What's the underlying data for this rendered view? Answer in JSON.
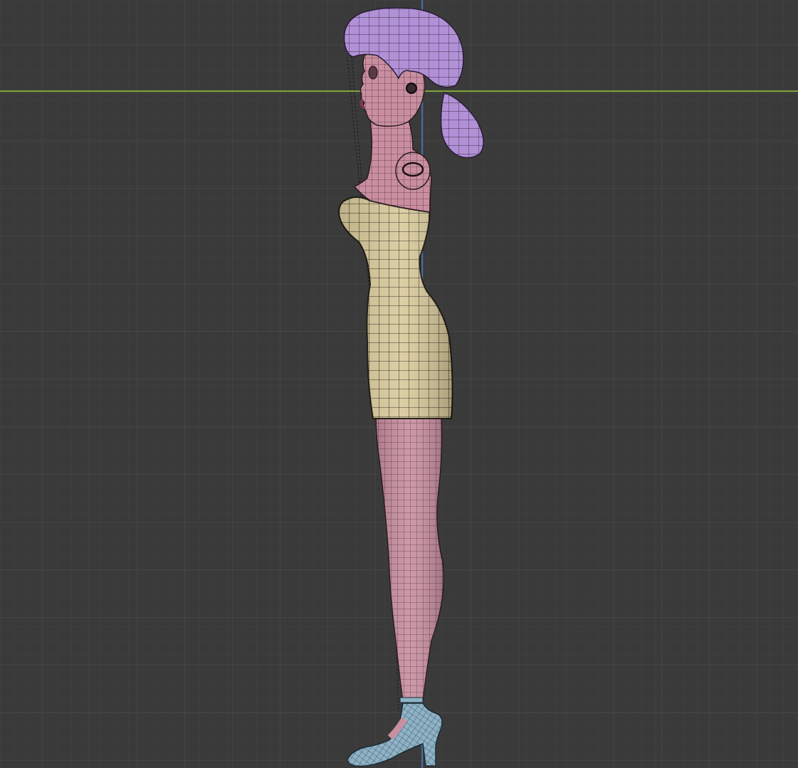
{
  "viewport": {
    "view": "side-orthographic",
    "grid": true,
    "colors": {
      "background": "#3a3a3a",
      "grid_minor": "#414141",
      "grid_major": "#4a4a4a",
      "axis_y": "#7fa535",
      "axis_z": "#4a7bc9",
      "skin": "#c98fa0",
      "skin_dark": "#a36b7c",
      "dress": "#d8c99a",
      "dress_dark": "#b8a574",
      "hair": "#b191d6",
      "hair_dark": "#8a6bb0",
      "shoe": "#8fb2c6",
      "wire": "#1a1a1a"
    }
  },
  "model": {
    "parts": [
      "hair-bun",
      "head",
      "neck",
      "upper-arm",
      "dress",
      "leg",
      "shoe"
    ],
    "earring_icon": "earring-icon"
  }
}
